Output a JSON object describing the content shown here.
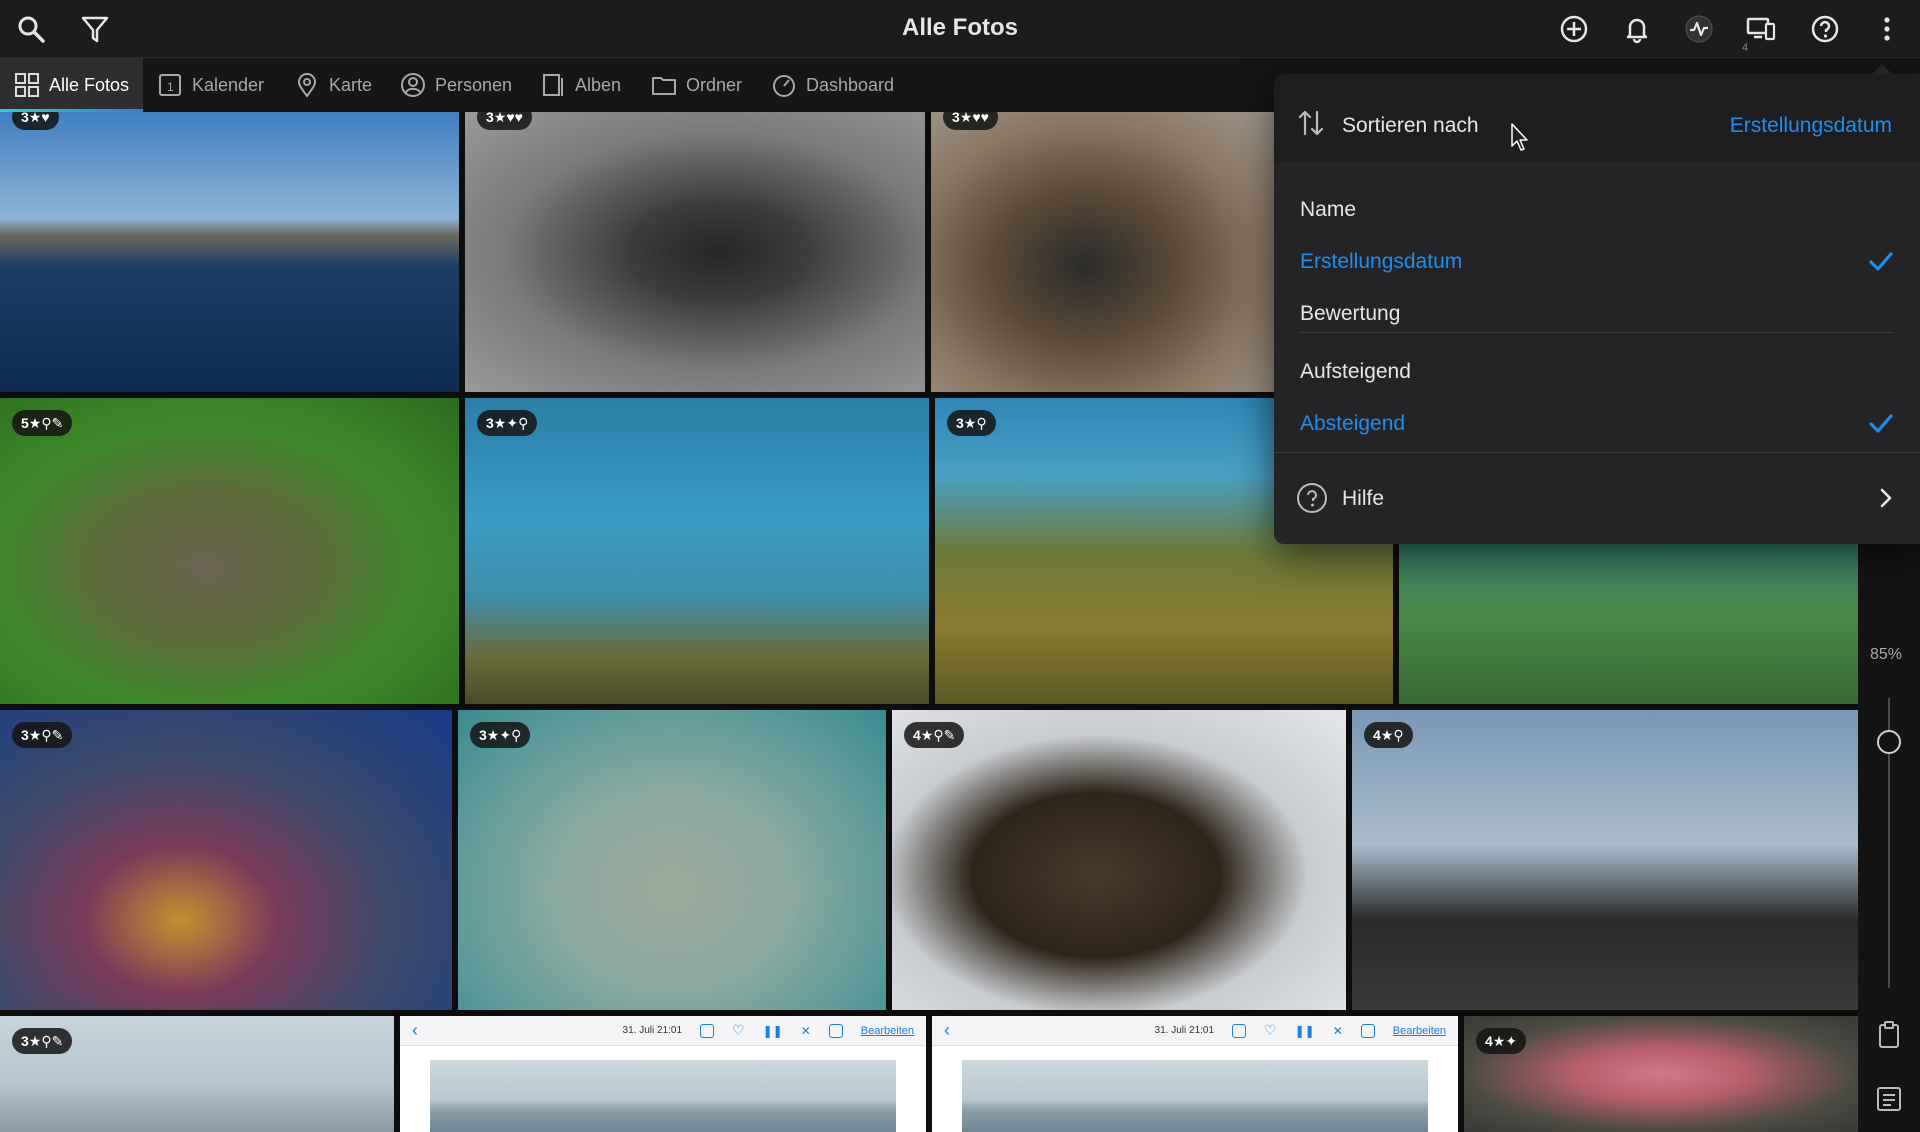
{
  "header": {
    "title": "Alle Fotos",
    "notification_count": "4"
  },
  "tabs": [
    {
      "label": "Alle Fotos",
      "icon": "grid-icon"
    },
    {
      "label": "Kalender",
      "icon": "calendar-icon"
    },
    {
      "label": "Karte",
      "icon": "map-pin-icon"
    },
    {
      "label": "Personen",
      "icon": "person-icon"
    },
    {
      "label": "Alben",
      "icon": "album-icon"
    },
    {
      "label": "Ordner",
      "icon": "folder-icon"
    },
    {
      "label": "Dashboard",
      "icon": "gauge-icon"
    }
  ],
  "photos": [
    {
      "rating": "3★♥",
      "desc": "island"
    },
    {
      "rating": "3★♥♥",
      "desc": "cormorant"
    },
    {
      "rating": "3★♥♥",
      "desc": "cormorant-seaweed"
    },
    {
      "rating": "5★⚲✎",
      "desc": "octopus"
    },
    {
      "rating": "3★✦⚲",
      "desc": "sea-lion-diving"
    },
    {
      "rating": "3★⚲",
      "desc": "marine-iguana"
    },
    {
      "rating": "",
      "desc": "iguana-algae"
    },
    {
      "rating": "3★⚲✎",
      "desc": "starfish-reef"
    },
    {
      "rating": "3★✦⚲",
      "desc": "batfish"
    },
    {
      "rating": "4★⚲✎",
      "desc": "sea-lions"
    },
    {
      "rating": "4★⚲",
      "desc": "fur-seal"
    },
    {
      "rating": "3★⚲✎",
      "desc": "iguana-water"
    },
    {
      "rating": "4★✦",
      "desc": "rock-coral"
    }
  ],
  "screenshots": [
    {
      "date": "31. Juli 21:01",
      "edit_label": "Bearbeiten"
    },
    {
      "date": "31. Juli 21:01",
      "edit_label": "Bearbeiten"
    }
  ],
  "rail": {
    "zoom_label": "85%",
    "zoom_value": 85
  },
  "menu": {
    "sort_label": "Sortieren nach",
    "sort_value": "Erstellungsdatum",
    "sort_options": [
      {
        "label": "Name",
        "selected": false
      },
      {
        "label": "Erstellungsdatum",
        "selected": true
      },
      {
        "label": "Bewertung",
        "selected": false
      }
    ],
    "order_options": [
      {
        "label": "Aufsteigend",
        "selected": false
      },
      {
        "label": "Absteigend",
        "selected": true
      }
    ],
    "help_label": "Hilfe"
  },
  "colors": {
    "accent": "#1f8ef1",
    "background": "#0d0d0d",
    "menu": "#242426"
  }
}
